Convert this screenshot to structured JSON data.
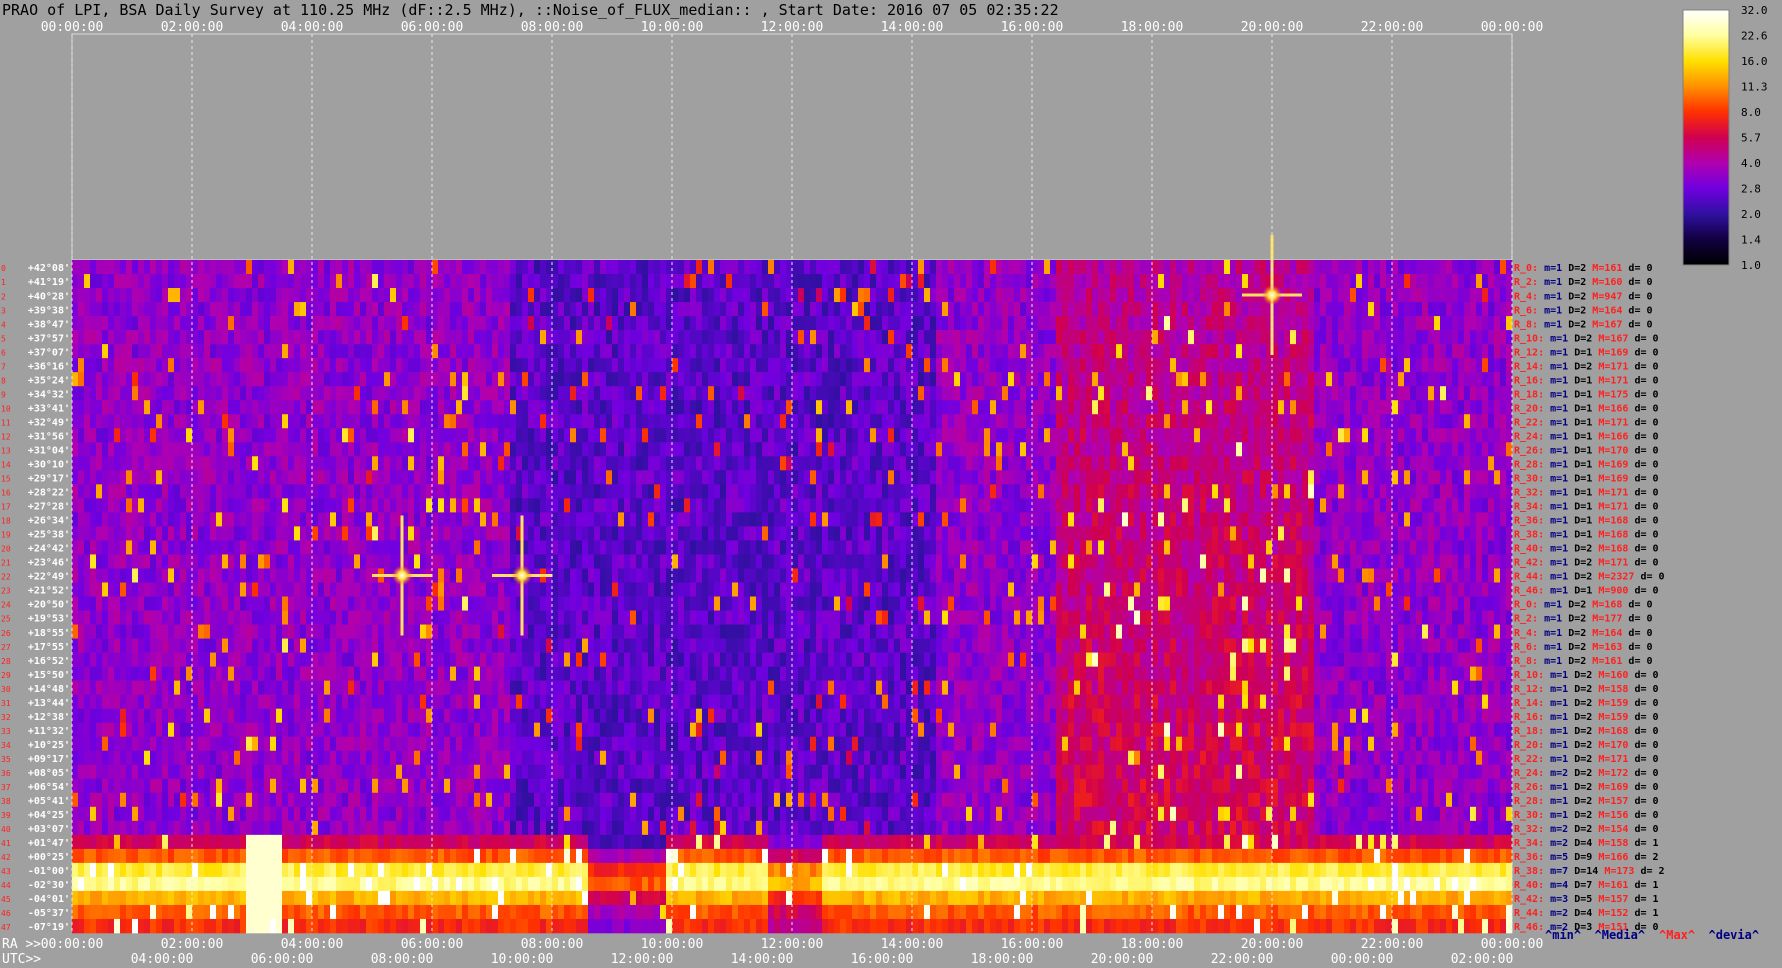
{
  "title": "PRAO of LPI, BSA Daily Survey at 110.25 MHz (dF::2.5 MHz), ::Noise_of_FLUX_median:: , Start Date: 2016 07 05 02:35:22",
  "chart_data": {
    "type": "heatmap",
    "top_time_ticks": [
      "00:00:00",
      "02:00:00",
      "04:00:00",
      "06:00:00",
      "08:00:00",
      "10:00:00",
      "12:00:00",
      "14:00:00",
      "16:00:00",
      "18:00:00",
      "20:00:00",
      "22:00:00",
      "00:00:00"
    ],
    "ra_ticks": [
      "00:00:00",
      "02:00:00",
      "04:00:00",
      "06:00:00",
      "08:00:00",
      "10:00:00",
      "12:00:00",
      "14:00:00",
      "16:00:00",
      "18:00:00",
      "20:00:00",
      "22:00:00",
      "00:00:00"
    ],
    "utc_ticks": [
      "04:00:00",
      "06:00:00",
      "08:00:00",
      "10:00:00",
      "12:00:00",
      "14:00:00",
      "16:00:00",
      "18:00:00",
      "20:00:00",
      "22:00:00",
      "00:00:00",
      "02:00:00"
    ],
    "ra_label": "RA >>",
    "utc_label": "UTC>>",
    "colorbar": {
      "labels": [
        "32.0",
        "22.6",
        "16.0",
        "11.3",
        "8.0",
        "5.7",
        "4.0",
        "2.8",
        "2.0",
        "1.4",
        "1.0"
      ],
      "stops": [
        "#ffffff",
        "#ffffa0",
        "#ffe000",
        "#ff9000",
        "#ff3000",
        "#d00050",
        "#b000b0",
        "#7000e0",
        "#3010a0",
        "#100040",
        "#000000"
      ]
    },
    "declinations": [
      "+42°08'",
      "+41°19'",
      "+40°28'",
      "+39°38'",
      "+38°47'",
      "+37°57'",
      "+37°07'",
      "+36°16'",
      "+35°24'",
      "+34°32'",
      "+33°41'",
      "+32°49'",
      "+31°56'",
      "+31°04'",
      "+30°10'",
      "+29°17'",
      "+28°22'",
      "+27°28'",
      "+26°34'",
      "+25°38'",
      "+24°42'",
      "+23°46'",
      "+22°49'",
      "+21°52'",
      "+20°50'",
      "+19°53'",
      "+18°55'",
      "+17°55'",
      "+16°52'",
      "+15°50'",
      "+14°48'",
      "+13°44'",
      "+12°38'",
      "+11°32'",
      "+10°25'",
      "+09°17'",
      "+08°05'",
      "+06°54'",
      "+05°41'",
      "+04°25'",
      "+03°07'",
      "+01°47'",
      "+00°25'",
      "-01°00'",
      "-02°30'",
      "-04°01'",
      "-05°37'",
      "-07°19'"
    ],
    "beam_numbers": [
      "0",
      "1",
      "2",
      "3",
      "4",
      "5",
      "6",
      "7",
      "8",
      "9",
      "10",
      "11",
      "12",
      "13",
      "14",
      "15",
      "16",
      "17",
      "18",
      "19",
      "20",
      "21",
      "22",
      "23",
      "24",
      "25",
      "26",
      "27",
      "28",
      "29",
      "30",
      "31",
      "32",
      "33",
      "34",
      "35",
      "36",
      "37",
      "38",
      "39",
      "40",
      "41",
      "42",
      "43",
      "44",
      "45",
      "46",
      "47"
    ],
    "stats": [
      {
        "r": "R_0:",
        "m": "m=1",
        "D": "D=2",
        "M": "M=161",
        "d": "d= 0"
      },
      {
        "r": "R_2:",
        "m": "m=1",
        "D": "D=2",
        "M": "M=160",
        "d": "d= 0"
      },
      {
        "r": "R_4:",
        "m": "m=1",
        "D": "D=2",
        "M": "M=947",
        "d": "d= 0"
      },
      {
        "r": "R_6:",
        "m": "m=1",
        "D": "D=2",
        "M": "M=164",
        "d": "d= 0"
      },
      {
        "r": "R_8:",
        "m": "m=1",
        "D": "D=2",
        "M": "M=167",
        "d": "d= 0"
      },
      {
        "r": "R_10:",
        "m": "m=1",
        "D": "D=2",
        "M": "M=167",
        "d": "d= 0"
      },
      {
        "r": "R_12:",
        "m": "m=1",
        "D": "D=1",
        "M": "M=169",
        "d": "d= 0"
      },
      {
        "r": "R_14:",
        "m": "m=1",
        "D": "D=2",
        "M": "M=171",
        "d": "d= 0"
      },
      {
        "r": "R_16:",
        "m": "m=1",
        "D": "D=1",
        "M": "M=171",
        "d": "d= 0"
      },
      {
        "r": "R_18:",
        "m": "m=1",
        "D": "D=1",
        "M": "M=175",
        "d": "d= 0"
      },
      {
        "r": "R_20:",
        "m": "m=1",
        "D": "D=1",
        "M": "M=166",
        "d": "d= 0"
      },
      {
        "r": "R_22:",
        "m": "m=1",
        "D": "D=1",
        "M": "M=171",
        "d": "d= 0"
      },
      {
        "r": "R_24:",
        "m": "m=1",
        "D": "D=1",
        "M": "M=166",
        "d": "d= 0"
      },
      {
        "r": "R_26:",
        "m": "m=1",
        "D": "D=1",
        "M": "M=170",
        "d": "d= 0"
      },
      {
        "r": "R_28:",
        "m": "m=1",
        "D": "D=1",
        "M": "M=169",
        "d": "d= 0"
      },
      {
        "r": "R_30:",
        "m": "m=1",
        "D": "D=1",
        "M": "M=169",
        "d": "d= 0"
      },
      {
        "r": "R_32:",
        "m": "m=1",
        "D": "D=1",
        "M": "M=171",
        "d": "d= 0"
      },
      {
        "r": "R_34:",
        "m": "m=1",
        "D": "D=1",
        "M": "M=171",
        "d": "d= 0"
      },
      {
        "r": "R_36:",
        "m": "m=1",
        "D": "D=1",
        "M": "M=168",
        "d": "d= 0"
      },
      {
        "r": "R_38:",
        "m": "m=1",
        "D": "D=1",
        "M": "M=168",
        "d": "d= 0"
      },
      {
        "r": "R_40:",
        "m": "m=1",
        "D": "D=2",
        "M": "M=168",
        "d": "d= 0"
      },
      {
        "r": "R_42:",
        "m": "m=1",
        "D": "D=2",
        "M": "M=171",
        "d": "d= 0"
      },
      {
        "r": "R_44:",
        "m": "m=1",
        "D": "D=2",
        "M": "M=2327",
        "d": "d= 0"
      },
      {
        "r": "R_46:",
        "m": "m=1",
        "D": "D=1",
        "M": "M=900",
        "d": "d= 0"
      },
      {
        "r": "R_0:",
        "m": "m=1",
        "D": "D=2",
        "M": "M=168",
        "d": "d= 0"
      },
      {
        "r": "R_2:",
        "m": "m=1",
        "D": "D=2",
        "M": "M=177",
        "d": "d= 0"
      },
      {
        "r": "R_4:",
        "m": "m=1",
        "D": "D=2",
        "M": "M=164",
        "d": "d= 0"
      },
      {
        "r": "R_6:",
        "m": "m=1",
        "D": "D=2",
        "M": "M=163",
        "d": "d= 0"
      },
      {
        "r": "R_8:",
        "m": "m=1",
        "D": "D=2",
        "M": "M=161",
        "d": "d= 0"
      },
      {
        "r": "R_10:",
        "m": "m=1",
        "D": "D=2",
        "M": "M=160",
        "d": "d= 0"
      },
      {
        "r": "R_12:",
        "m": "m=1",
        "D": "D=2",
        "M": "M=158",
        "d": "d= 0"
      },
      {
        "r": "R_14:",
        "m": "m=1",
        "D": "D=2",
        "M": "M=159",
        "d": "d= 0"
      },
      {
        "r": "R_16:",
        "m": "m=1",
        "D": "D=2",
        "M": "M=159",
        "d": "d= 0"
      },
      {
        "r": "R_18:",
        "m": "m=1",
        "D": "D=2",
        "M": "M=168",
        "d": "d= 0"
      },
      {
        "r": "R_20:",
        "m": "m=1",
        "D": "D=2",
        "M": "M=170",
        "d": "d= 0"
      },
      {
        "r": "R_22:",
        "m": "m=1",
        "D": "D=2",
        "M": "M=171",
        "d": "d= 0"
      },
      {
        "r": "R_24:",
        "m": "m=2",
        "D": "D=2",
        "M": "M=172",
        "d": "d= 0"
      },
      {
        "r": "R_26:",
        "m": "m=1",
        "D": "D=2",
        "M": "M=169",
        "d": "d= 0"
      },
      {
        "r": "R_28:",
        "m": "m=1",
        "D": "D=2",
        "M": "M=157",
        "d": "d= 0"
      },
      {
        "r": "R_30:",
        "m": "m=1",
        "D": "D=2",
        "M": "M=156",
        "d": "d= 0"
      },
      {
        "r": "R_32:",
        "m": "m=2",
        "D": "D=2",
        "M": "M=154",
        "d": "d= 0"
      },
      {
        "r": "R_34:",
        "m": "m=2",
        "D": "D=4",
        "M": "M=158",
        "d": "d= 1"
      },
      {
        "r": "R_36:",
        "m": "m=5",
        "D": "D=9",
        "M": "M=166",
        "d": "d= 2"
      },
      {
        "r": "R_38:",
        "m": "m=7",
        "D": "D=14",
        "M": "M=173",
        "d": "d= 2"
      },
      {
        "r": "R_40:",
        "m": "m=4",
        "D": "D=7",
        "M": "M=161",
        "d": "d= 1"
      },
      {
        "r": "R_42:",
        "m": "m=3",
        "D": "D=5",
        "M": "M=157",
        "d": "d= 1"
      },
      {
        "r": "R_44:",
        "m": "m=2",
        "D": "D=4",
        "M": "M=152",
        "d": "d= 1"
      },
      {
        "r": "R_46:",
        "m": "m=2",
        "D": "D=3",
        "M": "M=151",
        "d": "d= 0"
      }
    ],
    "bottom_controls": [
      {
        "label": "^min^",
        "color": "#000080"
      },
      {
        "label": "^Media^",
        "color": "#000080"
      },
      {
        "label": "^Max^",
        "color": "#ff2020"
      },
      {
        "label": "^devia^",
        "color": "#000080"
      }
    ],
    "features": [
      {
        "name": "galactic-plane-band",
        "dec_range": [
          "+03°07'",
          "-07°19'"
        ],
        "intensity": "high"
      },
      {
        "name": "Cas-A-source",
        "ra": "20:00:00",
        "dec": "+40°28'"
      },
      {
        "name": "Cyg-A-source",
        "ra": "07:30:00",
        "dec": "+22°49'"
      },
      {
        "name": "Tau-A-source",
        "ra": "05:30:00",
        "dec": "+22°49'"
      }
    ]
  }
}
